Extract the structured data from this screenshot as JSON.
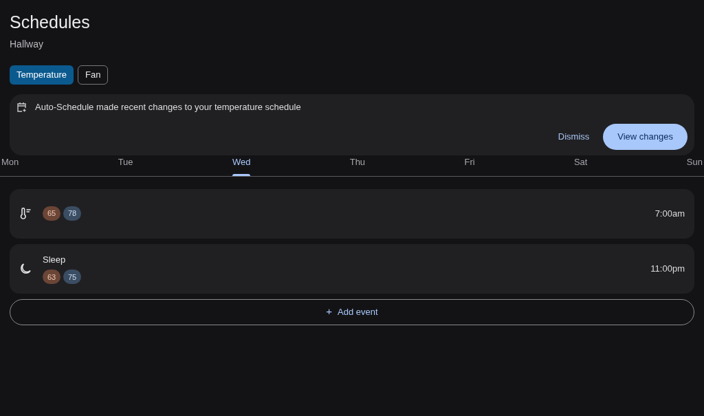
{
  "header": {
    "title": "Schedules",
    "subtitle": "Hallway"
  },
  "tabs": [
    {
      "label": "Temperature",
      "selected": true
    },
    {
      "label": "Fan",
      "selected": false
    }
  ],
  "banner": {
    "message": "Auto-Schedule made recent changes to your temperature schedule",
    "buttons": [
      {
        "label": "Dismiss",
        "kind": "text"
      },
      {
        "label": "View changes",
        "kind": "filled"
      }
    ]
  },
  "days": [
    {
      "label": "Mon",
      "selected": false
    },
    {
      "label": "Tue",
      "selected": false
    },
    {
      "label": "Wed",
      "selected": true
    },
    {
      "label": "Thu",
      "selected": false
    },
    {
      "label": "Fri",
      "selected": false
    },
    {
      "label": "Sat",
      "selected": false
    },
    {
      "label": "Sun",
      "selected": false
    }
  ],
  "events": [
    {
      "kind": "thermometer",
      "heat": "65",
      "cool": "78",
      "time": "7:00am"
    },
    {
      "kind": "sleep",
      "name": "Sleep",
      "heat": "63",
      "cool": "75",
      "time": "11:00pm"
    }
  ],
  "add_button": {
    "icon": "+",
    "label": "Add event"
  }
}
